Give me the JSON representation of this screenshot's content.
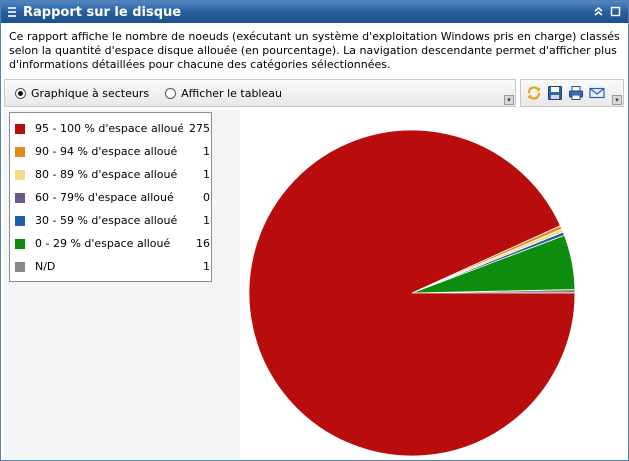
{
  "window": {
    "title": "Rapport sur le disque",
    "description": "Ce rapport affiche le nombre de noeuds (exécutant un système d'exploitation Windows pris en charge) classés selon la quantité d'espace disque allouée (en pourcentage). La navigation descendante permet d'afficher plus d'informations détaillées pour chacune des catégories sélectionnées."
  },
  "toolbar": {
    "view_options": [
      {
        "label": "Graphique à secteurs",
        "selected": true
      },
      {
        "label": "Afficher le tableau",
        "selected": false
      }
    ],
    "icons": [
      "refresh-icon",
      "save-icon",
      "print-icon",
      "email-icon"
    ]
  },
  "chart_data": {
    "type": "pie",
    "categories": [
      "95 - 100 % d'espace alloué",
      "90 - 94 % d'espace alloué",
      "80 - 89 % d'espace alloué",
      "60 - 79% d'espace alloué",
      "30 - 59 % d'espace alloué",
      "0 - 29 % d'espace alloué",
      "N/D"
    ],
    "values": [
      275,
      1,
      1,
      0,
      1,
      16,
      1
    ],
    "colors": [
      "#b90c0c",
      "#e08a1e",
      "#f5d98a",
      "#6a5a8a",
      "#1f5fa8",
      "#0e8c0e",
      "#888888"
    ],
    "legend_position": "top-left"
  }
}
